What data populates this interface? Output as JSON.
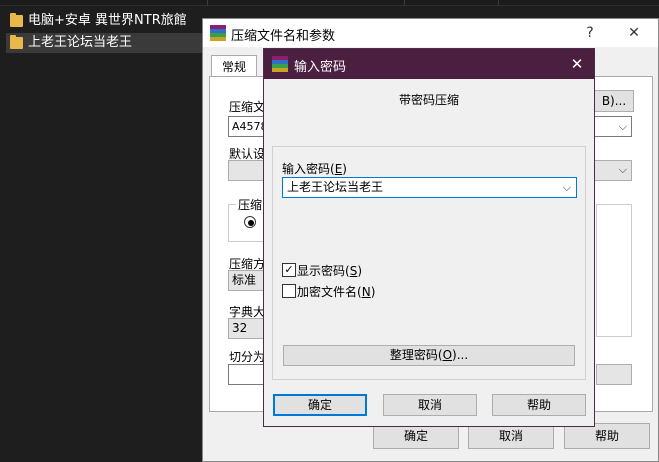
{
  "explorer": {
    "files": [
      {
        "name": "电脑+安卓 異世界NTR旅館",
        "selected": false
      },
      {
        "name": "上老王论坛当老王",
        "selected": true
      }
    ]
  },
  "main_window": {
    "title": "压缩文件名和参数",
    "help_btn": "?",
    "close_btn": "✕",
    "tab_general": "常规",
    "archive_name_label": "压缩文",
    "archive_name_value": "A4578",
    "browse_label": "B)...",
    "default_profile_label": "默认设",
    "format_group_label": "压缩",
    "method_label": "压缩方",
    "method_value": "标准",
    "dict_label": "字典大",
    "dict_value": "32",
    "split_label": "切分为",
    "ok": "确定",
    "cancel": "取消",
    "help": "帮助"
  },
  "dialog": {
    "title": "输入密码",
    "close": "✕",
    "heading": "带密码压缩",
    "password_label": "输入密码",
    "password_hotkey": "E",
    "password_value": "上老王论坛当老王",
    "show_password": {
      "label": "显示密码",
      "hotkey": "S",
      "checked": true
    },
    "encrypt_names": {
      "label": "加密文件名",
      "hotkey": "N",
      "checked": false
    },
    "organize_button": "整理密码",
    "organize_hotkey": "O",
    "ok": "确定",
    "cancel": "取消",
    "help": "帮助"
  }
}
